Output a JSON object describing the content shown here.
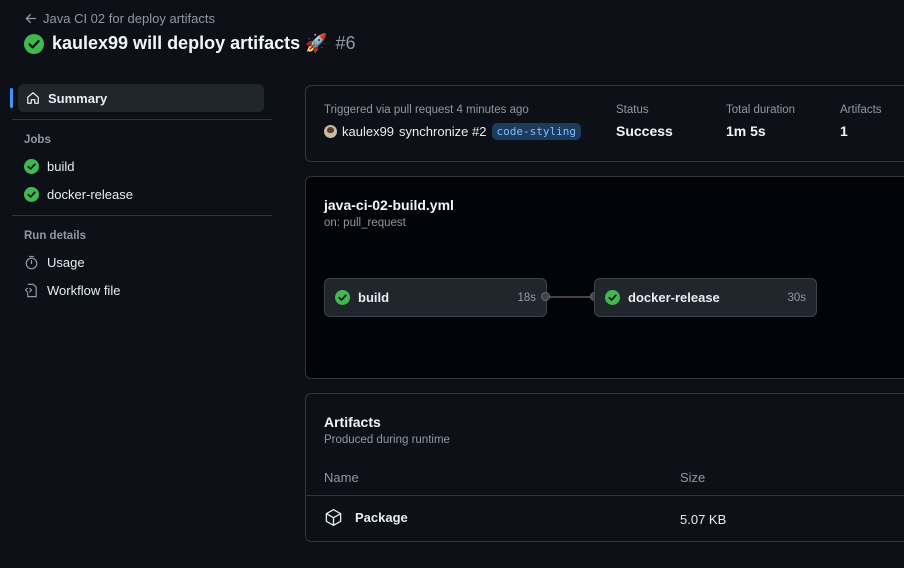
{
  "header": {
    "back_label": "Java CI 02 for deploy artifacts",
    "run_title": "kaulex99 will deploy artifacts 🚀",
    "run_number": "#6"
  },
  "sidebar": {
    "summary_label": "Summary",
    "jobs_heading": "Jobs",
    "jobs": [
      {
        "label": "build",
        "icon": "check-circle-icon"
      },
      {
        "label": "docker-release",
        "icon": "check-circle-icon"
      }
    ],
    "run_details_heading": "Run details",
    "details": [
      {
        "label": "Usage",
        "icon": "stopwatch-icon"
      },
      {
        "label": "Workflow file",
        "icon": "file-code-icon"
      }
    ]
  },
  "summary": {
    "trigger_text": "Triggered via pull request 4 minutes ago",
    "actor": "kaulex99",
    "action": "synchronize #2",
    "branch": "code-styling",
    "status_label": "Status",
    "status_value": "Success",
    "duration_label": "Total duration",
    "duration_value": "1m 5s",
    "artifacts_label": "Artifacts",
    "artifacts_value": "1"
  },
  "workflow": {
    "file_name": "java-ci-02-build.yml",
    "trigger": "on: pull_request",
    "jobs": [
      {
        "name": "build",
        "duration": "18s"
      },
      {
        "name": "docker-release",
        "duration": "30s"
      }
    ]
  },
  "artifacts": {
    "title": "Artifacts",
    "subtitle": "Produced during runtime",
    "col_name": "Name",
    "col_size": "Size",
    "rows": [
      {
        "name": "Package",
        "size": "5.07 KB",
        "icon": "package-icon"
      }
    ]
  },
  "colors": {
    "success": "#3fb950",
    "accent": "#4493f8",
    "background": "#0d1117"
  }
}
